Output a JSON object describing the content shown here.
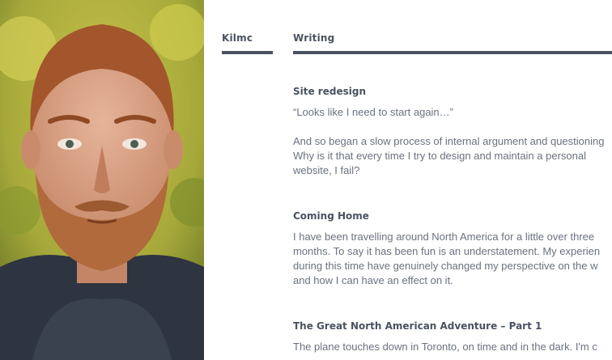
{
  "photo": {
    "alt": "",
    "colors": {
      "foliage": "#b9b83a",
      "foliage_dark": "#6d7a2a",
      "skin": "#d9a184",
      "hair": "#a3562c",
      "beard": "#b06a3c",
      "hoodie": "#2e3440"
    }
  },
  "nav": {
    "home_label": "Kilmc",
    "writing_label": "Writing",
    "accent": "#4a5261"
  },
  "posts": [
    {
      "title": "Site redesign",
      "paragraphs": [
        [
          "“Looks like I need to start again…”"
        ],
        [
          "And so began a slow process of internal argument and questioning",
          "Why is it that every time I try to design and maintain a personal",
          "website, I fail?"
        ]
      ]
    },
    {
      "title": "Coming Home",
      "paragraphs": [
        [
          "I have been travelling around North America for a little over three",
          "months. To say it has been fun is an understatement. My experien",
          "during this time have genuinely changed my perspective on the w",
          "and how I can have an effect on it."
        ]
      ]
    },
    {
      "title": "The Great North American Adventure – Part 1",
      "paragraphs": [
        [
          "The plane touches down in Toronto, on time and in the dark. I'm c"
        ]
      ]
    }
  ]
}
